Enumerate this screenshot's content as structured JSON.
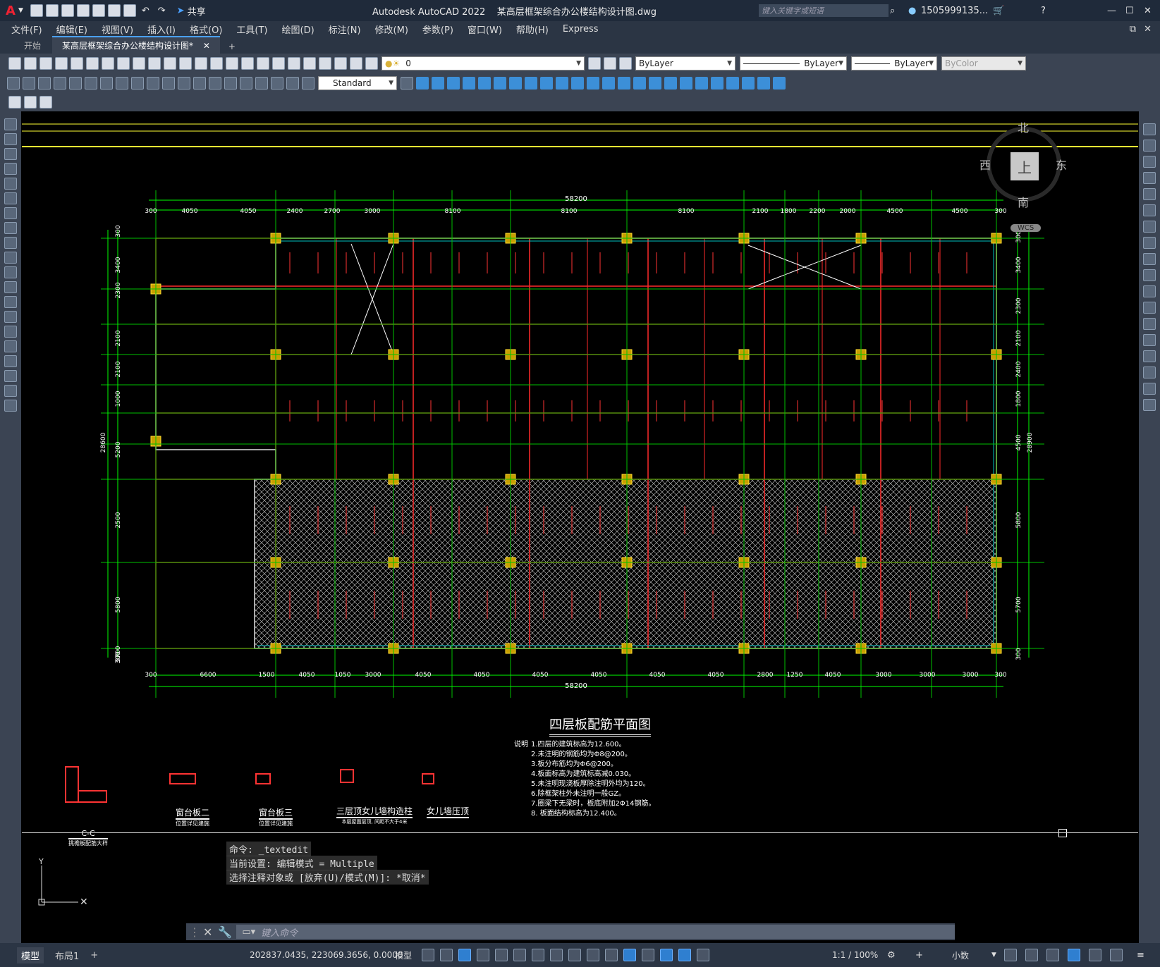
{
  "app": {
    "logo": "A",
    "title": "Autodesk AutoCAD 2022    某高层框架综合办公楼结构设计图.dwg",
    "share_label": "共享",
    "search_placeholder": "键入关键字或短语",
    "user": "1505999135...",
    "window_controls": [
      "minimize-icon",
      "maximize-icon",
      "close-icon"
    ]
  },
  "menu": [
    "文件(F)",
    "编辑(E)",
    "视图(V)",
    "插入(I)",
    "格式(O)",
    "工具(T)",
    "绘图(D)",
    "标注(N)",
    "修改(M)",
    "参数(P)",
    "窗口(W)",
    "帮助(H)",
    "Express"
  ],
  "tabs": [
    {
      "label": "开始",
      "active": false
    },
    {
      "label": "某高层框架综合办公楼结构设计图*",
      "active": true
    }
  ],
  "toolbar": {
    "layer_value": "0",
    "color_value": "ByLayer",
    "linetype_value": "ByLayer",
    "lineweight_value": "ByLayer",
    "plotstyle_value": "ByColor",
    "dimstyle_value": "Standard"
  },
  "viewcube": {
    "north": "北",
    "south": "南",
    "east": "东",
    "west": "西",
    "top": "上",
    "wcs": "WCS"
  },
  "drawing": {
    "total_top": "58200",
    "total_bottom": "58200",
    "top_dims": [
      "300",
      "4050",
      "4050",
      "2400",
      "2700",
      "3000",
      "8100",
      "8100",
      "8100",
      "2100",
      "1800",
      "2200",
      "2000",
      "4500",
      "4500",
      "300"
    ],
    "bottom_dims": [
      "300",
      "6600",
      "1500",
      "4050",
      "1050",
      "3000",
      "4050",
      "4050",
      "4050",
      "4050",
      "4050",
      "4050",
      "2800",
      "1250",
      "4050",
      "3000",
      "3000",
      "3000",
      "300"
    ],
    "left_dims": [
      "300",
      "3400",
      "2300",
      "2100",
      "2100",
      "1000",
      "5200",
      "2500",
      "5800",
      "5700",
      "300"
    ],
    "left_total": "28600",
    "right_dims": [
      "300",
      "3400",
      "2300",
      "2100",
      "2400",
      "1800",
      "4500",
      "5800",
      "5700",
      "300"
    ],
    "right_total": "28900",
    "plan_title": "四层板配筋平面图",
    "notes_head": "说明",
    "notes": [
      "1.四层的建筑标高为12.600。",
      "2.未注明的钢筋均为Φ8@200。",
      "3.板分布筋均为Φ6@200。",
      "4.板面标高为建筑标高减0.030。",
      "5.未注明现浇板厚除注明外均为120。",
      "6.除框架柱外未注明一般GZ。",
      "7.圈梁下无梁时，板底附加2Φ14钢筋。",
      "8.        板面结构标高为12.400。"
    ],
    "details": [
      {
        "title": "C-C",
        "sub": "挑檐板配筋大样"
      },
      {
        "title": "窗台板二",
        "sub": "位置详见建施"
      },
      {
        "title": "窗台板三",
        "sub": "位置详见建施"
      },
      {
        "title": "三层顶女儿墙构造柱",
        "sub": "本层屋面层顶, 间距不大于4米"
      },
      {
        "title": "女儿墙压顶",
        "sub": ""
      }
    ]
  },
  "command": {
    "history": [
      "命令: _textedit",
      "当前设置: 编辑模式 = Multiple",
      "选择注释对象或 [放弃(U)/模式(M)]: *取消*"
    ],
    "input_placeholder": "键入命令"
  },
  "layout_tabs": [
    "模型",
    "布局1"
  ],
  "status": {
    "coords": "202837.0435, 223069.3656, 0.0000",
    "space": "模型",
    "scale": "1:1 / 100%",
    "units": "小数"
  }
}
